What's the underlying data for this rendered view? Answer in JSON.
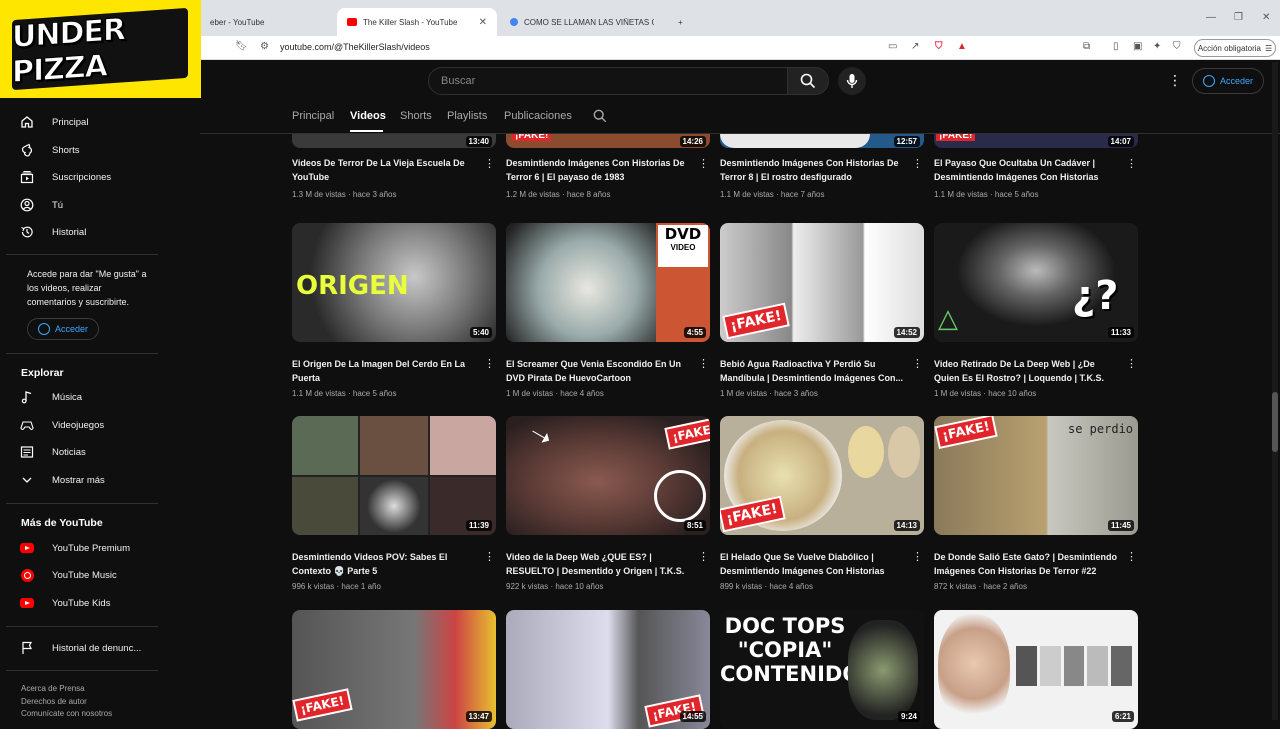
{
  "browser": {
    "tabs": [
      {
        "label": "eber - YouTube"
      },
      {
        "label": "The Killer Slash - YouTube"
      },
      {
        "label": "COMO SE LLAMAN LAS VIÑETAS GO"
      }
    ],
    "new_tab": "+",
    "url": "youtube.com/@TheKillerSlash/videos",
    "action_button": "Acción obligatoria"
  },
  "logo": {
    "text": "UNDER PIZZA"
  },
  "header": {
    "search_placeholder": "Buscar",
    "signin_label": "Acceder"
  },
  "channel_tabs": [
    "Principal",
    "Videos",
    "Shorts",
    "Playlists",
    "Publicaciones"
  ],
  "active_tab": "Videos",
  "sidebar": {
    "main": [
      {
        "label": "Principal",
        "icon": "home-icon"
      },
      {
        "label": "Shorts",
        "icon": "shorts-icon"
      },
      {
        "label": "Suscripciones",
        "icon": "subscriptions-icon"
      },
      {
        "label": "Tú",
        "icon": "you-icon"
      },
      {
        "label": "Historial",
        "icon": "history-icon"
      }
    ],
    "signin_note": "Accede para dar \"Me gusta\" a los videos, realizar comentarios y suscribirte.",
    "signin_label": "Acceder",
    "explore_heading": "Explorar",
    "explore": [
      {
        "label": "Música",
        "icon": "music-icon"
      },
      {
        "label": "Videojuegos",
        "icon": "gaming-icon"
      },
      {
        "label": "Noticias",
        "icon": "news-icon"
      },
      {
        "label": "Mostrar más",
        "icon": "chevron-down-icon"
      }
    ],
    "more_heading": "Más de YouTube",
    "more": [
      {
        "label": "YouTube Premium"
      },
      {
        "label": "YouTube Music"
      },
      {
        "label": "YouTube Kids"
      }
    ],
    "report": "Historial de denunc...",
    "footer": [
      "Acerca de  Prensa",
      "Derechos de autor",
      "Comunícate con nosotros"
    ]
  },
  "videos": [
    {
      "title": "Videos De Terror De La Vieja Escuela De YouTube",
      "meta": "1.3 M de vistas · hace 3 años",
      "duration": "13:40"
    },
    {
      "title": "Desmintiendo Imágenes Con Historias De Terror 6 | El payaso de 1983",
      "meta": "1.2 M de vistas · hace 8 años",
      "duration": "14:26"
    },
    {
      "title": "Desmintiendo Imágenes Con Historias De Terror 8 | El rostro desfigurado",
      "meta": "1.1 M de vistas · hace 7 años",
      "duration": "12:57"
    },
    {
      "title": "El Payaso Que Ocultaba Un Cadáver | Desmintiendo Imágenes Con Historias De...",
      "meta": "1.1 M de vistas · hace 5 años",
      "duration": "14:07"
    },
    {
      "title": "El Origen De La Imagen Del Cerdo En La Puerta",
      "meta": "1.1 M de vistas · hace 5 años",
      "duration": "5:40"
    },
    {
      "title": "El Screamer Que Venia Escondido En Un DVD Pirata De HuevoCartoon",
      "meta": "1 M de vistas · hace 4 años",
      "duration": "4:55"
    },
    {
      "title": "Bebió Agua Radioactiva Y Perdió Su Mandíbula | Desmintiendo Imágenes Con...",
      "meta": "1 M de vistas · hace 3 años",
      "duration": "14:52"
    },
    {
      "title": "Video Retirado De La Deep Web | ¿De Quien Es El Rostro? | Loquendo | T.K.S.",
      "meta": "1 M de vistas · hace 10 años",
      "duration": "11:33"
    },
    {
      "title": "Desmintiendo Videos POV: Sabes El Contexto 💀 Parte 5",
      "meta": "996 k vistas · hace 1 año",
      "duration": "11:39"
    },
    {
      "title": "Video de la Deep Web ¿QUE ES? | RESUELTO | Desmentido y Origen | T.K.S.",
      "meta": "922 k vistas · hace 10 años",
      "duration": "8:51"
    },
    {
      "title": "El Helado Que Se Vuelve Diabólico | Desmintiendo Imágenes Con Historias De...",
      "meta": "899 k vistas · hace 4 años",
      "duration": "14:13"
    },
    {
      "title": "De Donde Salió Este Gato? | Desmintiendo Imágenes Con Historias De Terror #22",
      "meta": "872 k vistas · hace 2 años",
      "duration": "11:45"
    },
    {
      "title": "",
      "meta": "",
      "duration": "13:47"
    },
    {
      "title": "",
      "meta": "",
      "duration": "14:55"
    },
    {
      "title": "",
      "meta": "",
      "duration": "9:24"
    },
    {
      "title": "",
      "meta": "",
      "duration": "6:21"
    }
  ],
  "thumb_text": {
    "fake": "¡FAKE!",
    "origen": "ORIGEN",
    "dvd": "DVD",
    "video": "VIDEO",
    "se_perdio": "se perdio",
    "doc_tops_1": "DOC TOPS",
    "doc_tops_2": "\"COPIA\"",
    "doc_tops_3": "CONTENIDO"
  }
}
